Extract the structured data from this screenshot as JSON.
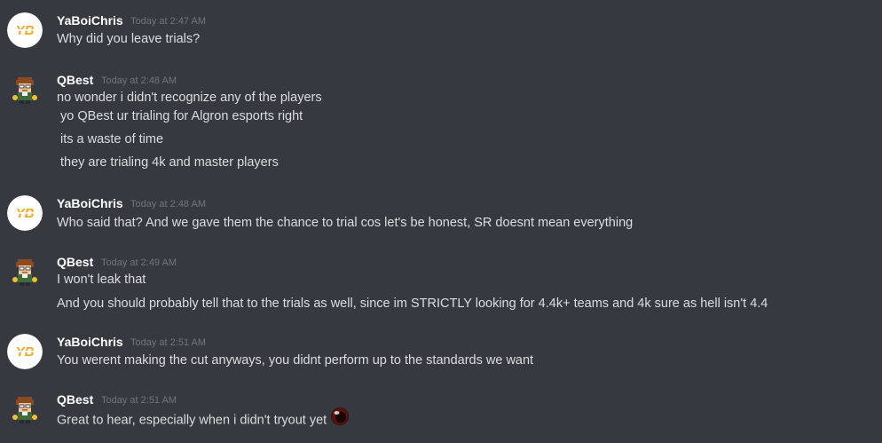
{
  "messages": [
    {
      "author": "YaBoiChris",
      "avatar": "yb-logo-avatar",
      "timestamp": "Today at 2:47 AM",
      "lines": [
        "Why did you leave trials?"
      ]
    },
    {
      "author": "QBest",
      "avatar": "pixel-character-avatar",
      "timestamp": "Today at 2:48 AM",
      "lines": [
        "no wonder i didn't recognize any of the players",
        "yo QBest ur trialing for Algron esports right",
        "its a waste of time",
        "they are trialing 4k and master players"
      ]
    },
    {
      "author": "YaBoiChris",
      "avatar": "yb-logo-avatar",
      "timestamp": "Today at 2:48 AM",
      "lines": [
        "Who said that? And we gave them the chance to trial cos let's be honest, SR doesnt mean everything"
      ]
    },
    {
      "author": "QBest",
      "avatar": "pixel-character-avatar",
      "timestamp": "Today at 2:49 AM",
      "lines": [
        "I won't leak that",
        "And you should probably tell that to the trials as well, since im STRICTLY looking for 4.4k+ teams and 4k sure as hell isn't 4.4"
      ]
    },
    {
      "author": "YaBoiChris",
      "avatar": "yb-logo-avatar",
      "timestamp": "Today at 2:51 AM",
      "lines": [
        "You werent making the cut anyways, you didnt perform up to the standards we want"
      ]
    },
    {
      "author": "QBest",
      "avatar": "pixel-character-avatar",
      "timestamp": "Today at 2:51 AM",
      "lines": [
        "Great to hear, especially when i didn't tryout yet"
      ],
      "trailing_emoji": "dark-red-ball-emoji"
    }
  ],
  "colors": {
    "background": "#36393f",
    "username": "#ffffff",
    "timestamp": "#72767d",
    "message_text": "#dcddde",
    "yb_logo_orange": "#f5a623"
  }
}
